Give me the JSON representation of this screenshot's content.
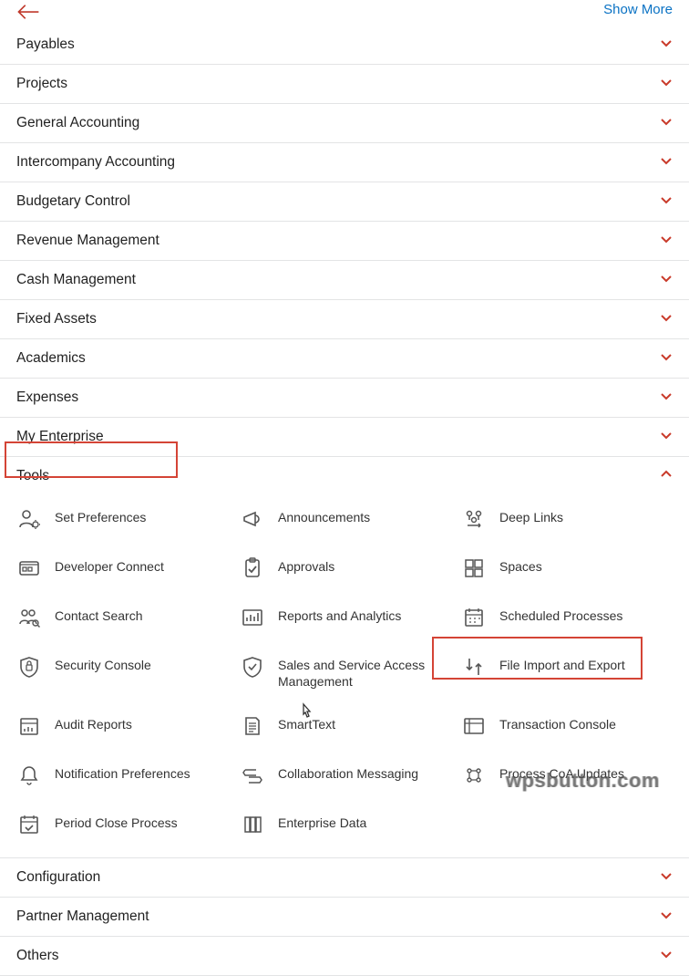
{
  "header": {
    "show_more": "Show More"
  },
  "sections": {
    "payables": "Payables",
    "projects": "Projects",
    "general_accounting": "General Accounting",
    "intercompany_accounting": "Intercompany Accounting",
    "budgetary_control": "Budgetary Control",
    "revenue_management": "Revenue Management",
    "cash_management": "Cash Management",
    "fixed_assets": "Fixed Assets",
    "academics": "Academics",
    "expenses": "Expenses",
    "my_enterprise": "My Enterprise",
    "tools": "Tools",
    "configuration": "Configuration",
    "partner_management": "Partner Management",
    "others": "Others"
  },
  "tools": {
    "set_preferences": "Set Preferences",
    "announcements": "Announcements",
    "deep_links": "Deep Links",
    "developer_connect": "Developer Connect",
    "approvals": "Approvals",
    "spaces": "Spaces",
    "contact_search": "Contact Search",
    "reports_analytics": "Reports and Analytics",
    "scheduled_processes": "Scheduled Processes",
    "security_console": "Security Console",
    "sales_service_access": "Sales and Service Access Management",
    "file_import_export": "File Import and Export",
    "audit_reports": "Audit Reports",
    "smarttext": "SmartText",
    "transaction_console": "Transaction Console",
    "notification_preferences": "Notification Preferences",
    "collaboration_messaging": "Collaboration Messaging",
    "process_coa_updates": "Process CoA Updates",
    "period_close_process": "Period Close Process",
    "enterprise_data": "Enterprise Data"
  },
  "watermark": "wpsbutton.com"
}
